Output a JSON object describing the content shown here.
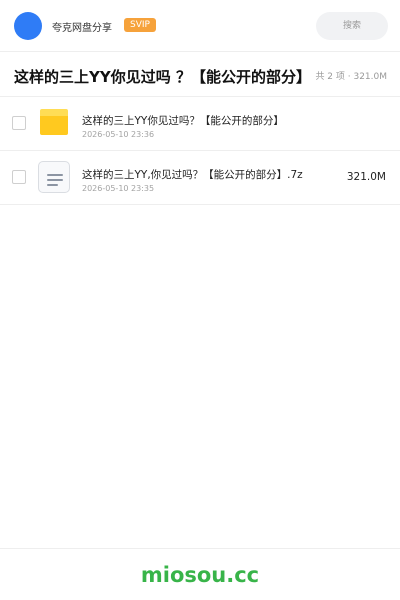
{
  "header": {
    "app_name": "夸克网盘分享",
    "badge": "SVIP",
    "search_placeholder": "搜索"
  },
  "title_bar": {
    "title": "这样的三上YY你见过吗 ？【能公开的部分】",
    "summary": "共 2 项 · 321.0M"
  },
  "files": [
    {
      "type": "folder",
      "icon": "folder-icon",
      "name": "这样的三上YY你见过吗？【能公开的部分】",
      "date": "2026-05-10 23:36",
      "size": ""
    },
    {
      "type": "file",
      "icon": "archive-file-icon",
      "name": "这样的三上YY,你见过吗？【能公开的部分】.7z",
      "date": "2026-05-10 23:35",
      "size": "321.0M"
    }
  ],
  "footer": {
    "watermark": "miosou.cc"
  },
  "colors": {
    "avatar": "#2f7cf6",
    "badge": "#f6a23b",
    "folder": "#ffc91f",
    "watermark": "#38b449"
  }
}
